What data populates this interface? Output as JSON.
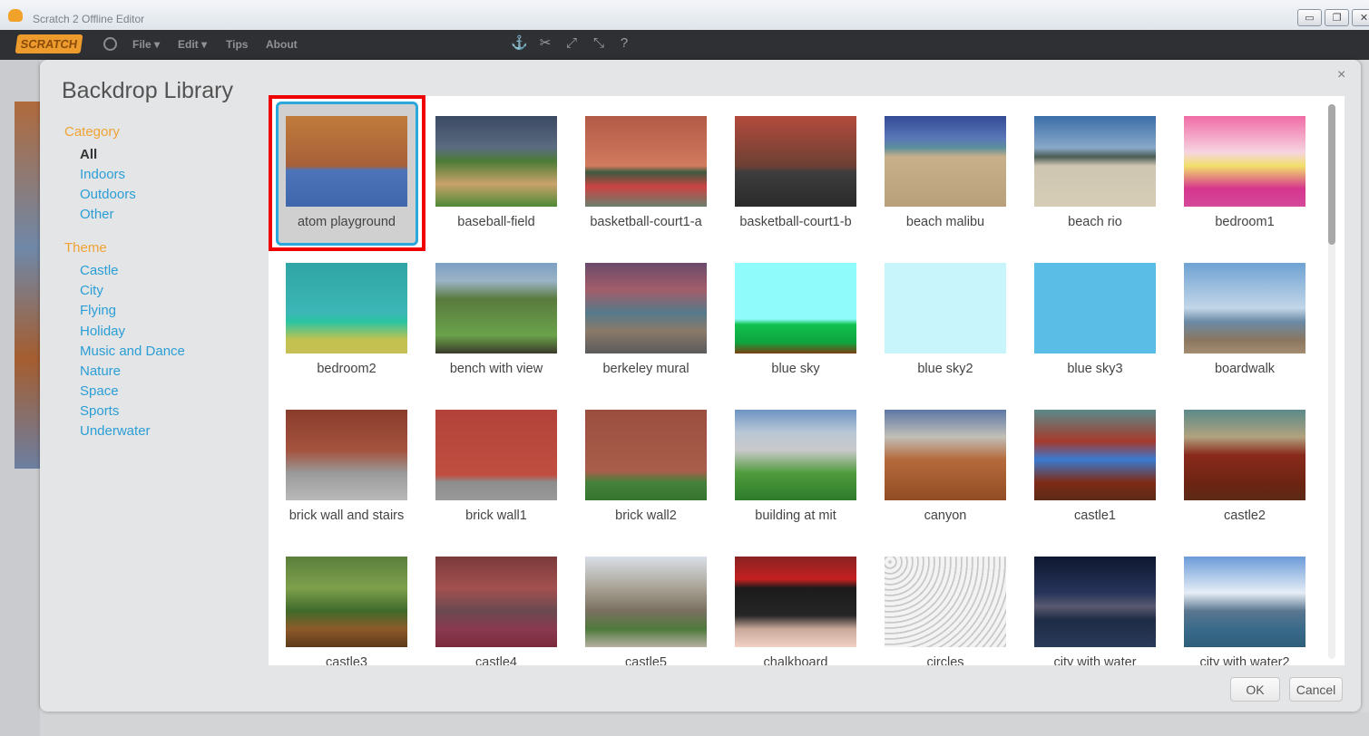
{
  "window": {
    "title": "Scratch 2 Offline Editor"
  },
  "menu": {
    "logo": "SCRATCH",
    "items": [
      "File ▾",
      "Edit ▾",
      "Tips",
      "About"
    ]
  },
  "dialog": {
    "title": "Backdrop Library",
    "close": "×",
    "category_heading": "Category",
    "categories": [
      "All",
      "Indoors",
      "Outdoors",
      "Other"
    ],
    "selected_category": "All",
    "theme_heading": "Theme",
    "themes": [
      "Castle",
      "City",
      "Flying",
      "Holiday",
      "Music and Dance",
      "Nature",
      "Space",
      "Sports",
      "Underwater"
    ],
    "ok": "OK",
    "cancel": "Cancel"
  },
  "backdrops": [
    "atom playground",
    "baseball-field",
    "basketball-court1-a",
    "basketball-court1-b",
    "beach malibu",
    "beach rio",
    "bedroom1",
    "bedroom2",
    "bench with view",
    "berkeley mural",
    "blue sky",
    "blue sky2",
    "blue sky3",
    "boardwalk",
    "brick wall and stairs",
    "brick wall1",
    "brick wall2",
    "building at mit",
    "canyon",
    "castle1",
    "castle2",
    "castle3",
    "castle4",
    "castle5",
    "chalkboard",
    "circles",
    "city with water",
    "city with water2"
  ],
  "selected_backdrop": "atom playground",
  "colors": {
    "accent_selected": "#2aa8dc",
    "highlight": "#e00000",
    "link": "#2a9ed6",
    "section": "#f0a233"
  }
}
